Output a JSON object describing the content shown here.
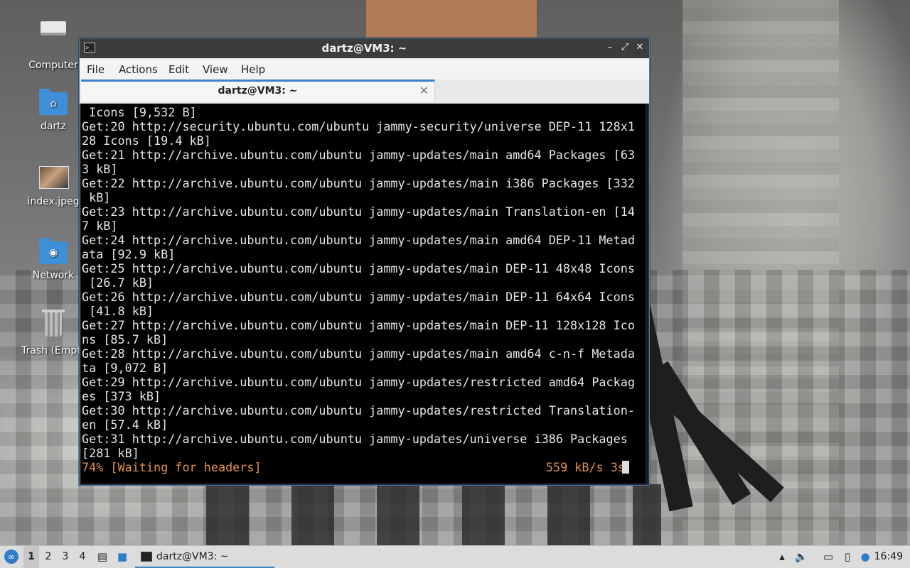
{
  "desktop": {
    "icons": [
      {
        "label": "Computer",
        "icon": "computer-icon"
      },
      {
        "label": "dartz",
        "icon": "home-folder-icon"
      },
      {
        "label": "index.jpeg",
        "icon": "image-file-icon"
      },
      {
        "label": "Network",
        "icon": "network-folder-icon"
      },
      {
        "label": "Trash (Empty)",
        "icon": "trash-icon"
      }
    ]
  },
  "window": {
    "title": "dartz@VM3: ~",
    "controls": {
      "minimize": "–",
      "maximize": "⤢",
      "close": "✕"
    },
    "menu": [
      "File",
      "Actions",
      "Edit",
      "View",
      "Help"
    ],
    "tab": {
      "label": "dartz@VM3: ~",
      "close": "✕"
    },
    "terminal": {
      "lines": [
        " Icons [9,532 B]",
        "Get:20 http://security.ubuntu.com/ubuntu jammy-security/universe DEP-11 128x1",
        "28 Icons [19.4 kB]",
        "Get:21 http://archive.ubuntu.com/ubuntu jammy-updates/main amd64 Packages [63",
        "3 kB]",
        "Get:22 http://archive.ubuntu.com/ubuntu jammy-updates/main i386 Packages [332",
        " kB]",
        "Get:23 http://archive.ubuntu.com/ubuntu jammy-updates/main Translation-en [14",
        "7 kB]",
        "Get:24 http://archive.ubuntu.com/ubuntu jammy-updates/main amd64 DEP-11 Metad",
        "ata [92.9 kB]",
        "Get:25 http://archive.ubuntu.com/ubuntu jammy-updates/main DEP-11 48x48 Icons",
        " [26.7 kB]",
        "Get:26 http://archive.ubuntu.com/ubuntu jammy-updates/main DEP-11 64x64 Icons",
        " [41.8 kB]",
        "Get:27 http://archive.ubuntu.com/ubuntu jammy-updates/main DEP-11 128x128 Ico",
        "ns [85.7 kB]",
        "Get:28 http://archive.ubuntu.com/ubuntu jammy-updates/main amd64 c-n-f Metada",
        "ta [9,072 B]",
        "Get:29 http://archive.ubuntu.com/ubuntu jammy-updates/restricted amd64 Packag",
        "es [373 kB]",
        "Get:30 http://archive.ubuntu.com/ubuntu jammy-updates/restricted Translation-",
        "en [57.4 kB]",
        "Get:31 http://archive.ubuntu.com/ubuntu jammy-updates/universe i386 Packages",
        "[281 kB]"
      ],
      "status_left": "74% [Waiting for headers]",
      "status_right": "559 kB/s 3s",
      "status_color": "#e0914f"
    }
  },
  "taskbar": {
    "start_icon": "lubuntu-logo-icon",
    "workspaces": [
      "1",
      "2",
      "3",
      "4"
    ],
    "active_workspace": "1",
    "quick_launch": [
      "file-manager-icon",
      "show-desktop-icon"
    ],
    "task": {
      "label": "dartz@VM3: ~",
      "icon": "terminal-icon"
    },
    "tray": [
      "removable-drive-icon",
      "volume-icon",
      "network-icon",
      "clipboard-icon",
      "notification-icon"
    ],
    "clock": "16:49"
  },
  "colors": {
    "accent": "#3b84c8",
    "titlebar": "#3c3c3c",
    "terminal_bg": "#000000"
  }
}
